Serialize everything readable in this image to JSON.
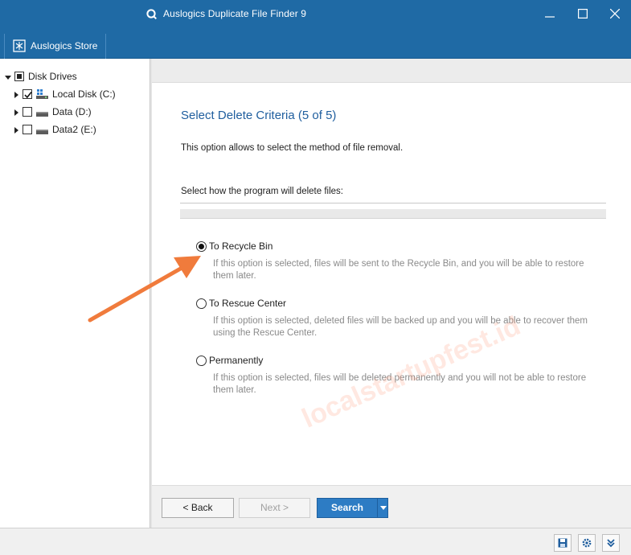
{
  "window": {
    "title": "Auslogics Duplicate File Finder 9",
    "controls": {
      "minimize": "minimize-icon",
      "maximize": "maximize-icon",
      "close": "close-icon"
    }
  },
  "menubar": {
    "store_label": "Auslogics Store"
  },
  "tree": {
    "root": {
      "label": "Disk Drives",
      "state": "indeterminate",
      "expanded": true
    },
    "items": [
      {
        "label": "Local Disk (C:)",
        "checked": true,
        "icon": "system-drive-icon"
      },
      {
        "label": "Data (D:)",
        "checked": false,
        "icon": "drive-icon"
      },
      {
        "label": "Data2 (E:)",
        "checked": false,
        "icon": "drive-icon"
      }
    ]
  },
  "wizard": {
    "title": "Select Delete Criteria (5 of 5)",
    "description": "This option allows to select the method of file removal.",
    "section_label": "Select how the program will delete files:",
    "options": [
      {
        "label": "To Recycle Bin",
        "selected": true,
        "description": "If this option is selected, files will be sent to the Recycle Bin, and you will be able to restore them later."
      },
      {
        "label": "To Rescue Center",
        "selected": false,
        "description": "If this option is selected, deleted files will be backed up and you will be able to recover them using the Rescue Center."
      },
      {
        "label": "Permanently",
        "selected": false,
        "description": "If this option is selected, files will be deleted permanently and you will not be able to restore them later."
      }
    ]
  },
  "footer": {
    "back_label": "< Back",
    "next_label": "Next >",
    "search_label": "Search"
  },
  "statusbar": {
    "icons": [
      "save-icon",
      "settings-icon",
      "expand-down-icon"
    ]
  },
  "watermark": "localstartupfest.id",
  "colors": {
    "titlebar": "#1f6aa5",
    "accent_title": "#1f5e9e",
    "search_button": "#2d7cc4",
    "annotation_arrow": "#f07b3c"
  }
}
